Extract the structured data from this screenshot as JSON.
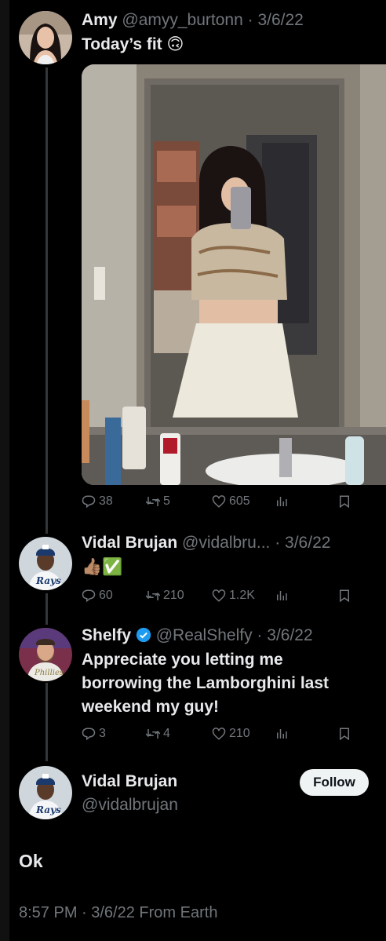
{
  "tweet1": {
    "name": "Amy",
    "handle": "@amyy_burtonn",
    "date": "3/6/22",
    "text": "Today’s fit 🙃",
    "stats": {
      "replies": "38",
      "retweets": "5",
      "likes": "605"
    }
  },
  "tweet2": {
    "name": "Vidal Brujan",
    "handle": "@vidalbru...",
    "date": "3/6/22",
    "text": "👍🏽✅",
    "stats": {
      "replies": "60",
      "retweets": "210",
      "likes": "1.2K"
    }
  },
  "tweet3": {
    "name": "Shelfy",
    "handle": "@RealShelfy",
    "date": "3/6/22",
    "text_lines": [
      "Appreciate you letting me",
      "borrowing the Lamborghini last",
      "weekend my guy!"
    ],
    "stats": {
      "replies": "3",
      "retweets": "4",
      "likes": "210"
    }
  },
  "main_tweet": {
    "name": "Vidal Brujan",
    "handle": "@vidalbrujan",
    "follow_label": "Follow",
    "text": "Ok",
    "timestamp": "8:57 PM · 3/6/22 From Earth"
  },
  "icons": {
    "reply": "reply-icon",
    "retweet": "retweet-icon",
    "like": "heart-icon",
    "views": "analytics-icon",
    "bookmark": "bookmark-icon",
    "share": "share-icon",
    "verified": "verified-badge-icon"
  },
  "colors": {
    "background": "#000000",
    "primary_text": "#e7e9ea",
    "secondary_text": "#71767b",
    "verified_blue": "#1d9bf0",
    "follow_bg": "#eff3f4"
  },
  "separator": "·"
}
